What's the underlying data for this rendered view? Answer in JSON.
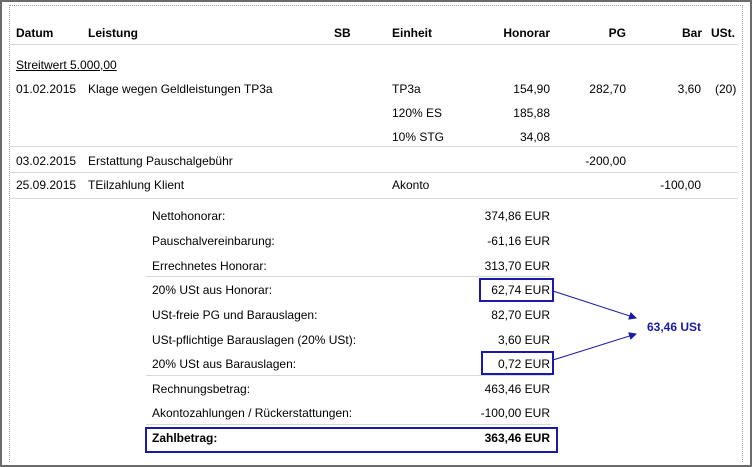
{
  "columns": {
    "datum": "Datum",
    "leistung": "Leistung",
    "sb": "SB",
    "einheit": "Einheit",
    "honorar": "Honorar",
    "pg": "PG",
    "bar": "Bar",
    "ust": "USt."
  },
  "streitwert": "Streitwert 5.000,00",
  "rows": [
    {
      "datum": "01.02.2015",
      "leistung": "Klage wegen Geldleistungen TP3a",
      "einheit": "TP3a",
      "honorar": "154,90",
      "pg": "282,70",
      "bar": "3,60",
      "ust": "(20)"
    },
    {
      "datum": "",
      "leistung": "",
      "einheit": "120% ES",
      "honorar": "185,88",
      "pg": "",
      "bar": "",
      "ust": ""
    },
    {
      "datum": "",
      "leistung": "",
      "einheit": "10% STG",
      "honorar": "34,08",
      "pg": "",
      "bar": "",
      "ust": ""
    },
    {
      "datum": "03.02.2015",
      "leistung": "Erstattung Pauschalgebühr",
      "einheit": "",
      "honorar": "",
      "pg": "-200,00",
      "bar": "",
      "ust": ""
    },
    {
      "datum": "25.09.2015",
      "leistung": "TEilzahlung Klient",
      "einheit": "Akonto",
      "honorar": "",
      "pg": "",
      "bar": "-100,00",
      "ust": ""
    }
  ],
  "summary": [
    {
      "label": "Nettohonorar:",
      "value": "374,86 EUR"
    },
    {
      "label": "Pauschalvereinbarung:",
      "value": "-61,16 EUR"
    },
    {
      "label": "Errechnetes Honorar:",
      "value": "313,70 EUR"
    },
    {
      "label": "20% USt aus Honorar:",
      "value": "62,74 EUR"
    },
    {
      "label": "USt-freie PG und Barauslagen:",
      "value": "82,70 EUR"
    },
    {
      "label": "USt-pflichtige Barauslagen (20% USt):",
      "value": "3,60 EUR"
    },
    {
      "label": "20% USt aus Barauslagen:",
      "value": "0,72 EUR"
    },
    {
      "label": "Rechnungsbetrag:",
      "value": "463,46 EUR"
    },
    {
      "label": "Akontozahlungen / Rückerstattungen:",
      "value": "-100,00 EUR"
    }
  ],
  "total": {
    "label": "Zahlbetrag:",
    "value": "363,46 EUR"
  },
  "callout": "63,46 USt",
  "colors": {
    "accent": "#1a1aa8",
    "frame": "#6b6b6b",
    "separator": "#d8d8d8"
  }
}
